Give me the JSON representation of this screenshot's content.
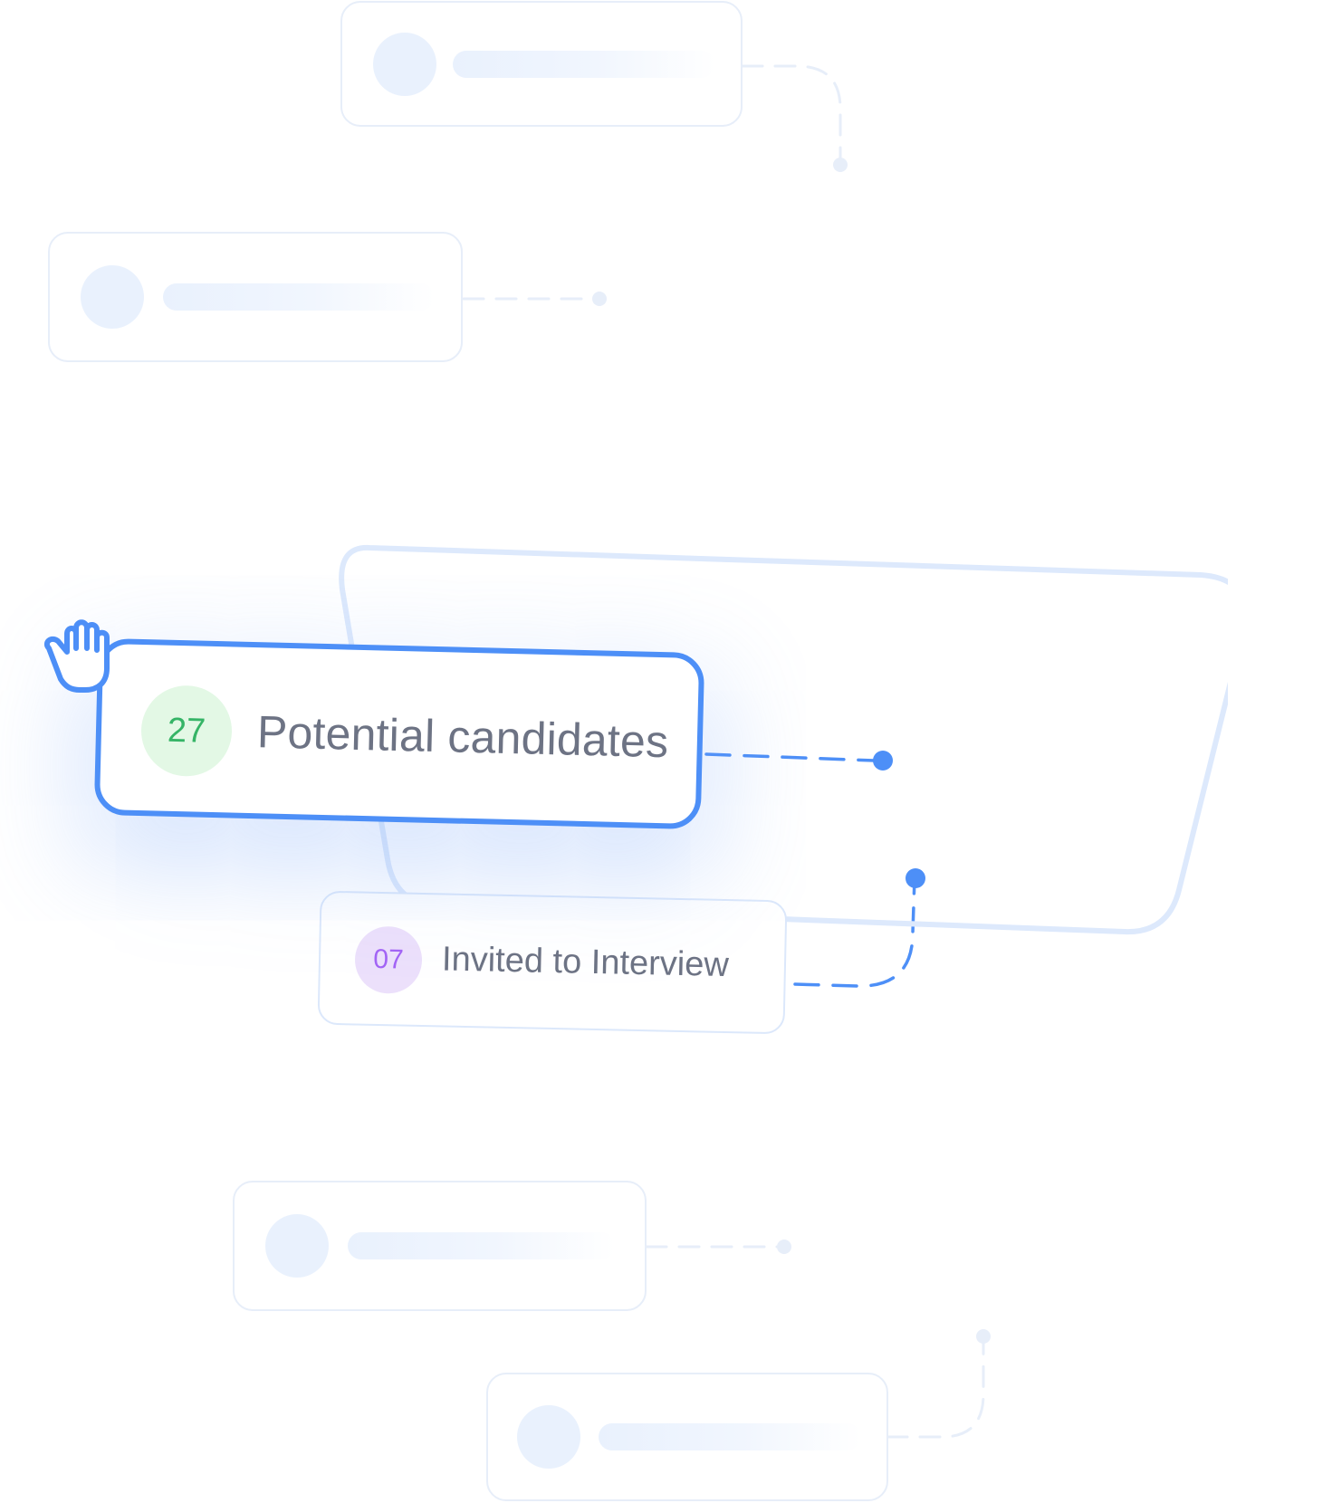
{
  "colors": {
    "accent": "#4d8ff7",
    "ghost_border": "#e7eef9",
    "ghost_fill": "#e9f1fd",
    "panel_outline": "#dde9fc",
    "green_chip_bg": "#e3f8e5",
    "green_chip_text": "#35b466",
    "purple_chip_bg": "#ece0fb",
    "purple_chip_text": "#a364f5",
    "label_text": "#6d7384"
  },
  "pipeline": {
    "potential_candidates": {
      "count": "27",
      "label": "Potential candidates",
      "state": "being dragged"
    },
    "invited_to_interview": {
      "count": "07",
      "label": "Invited to Interview"
    }
  },
  "cursor": {
    "icon": "grab-hand-icon"
  },
  "placeholders": {
    "count": 4,
    "kind": "skeleton-card"
  }
}
